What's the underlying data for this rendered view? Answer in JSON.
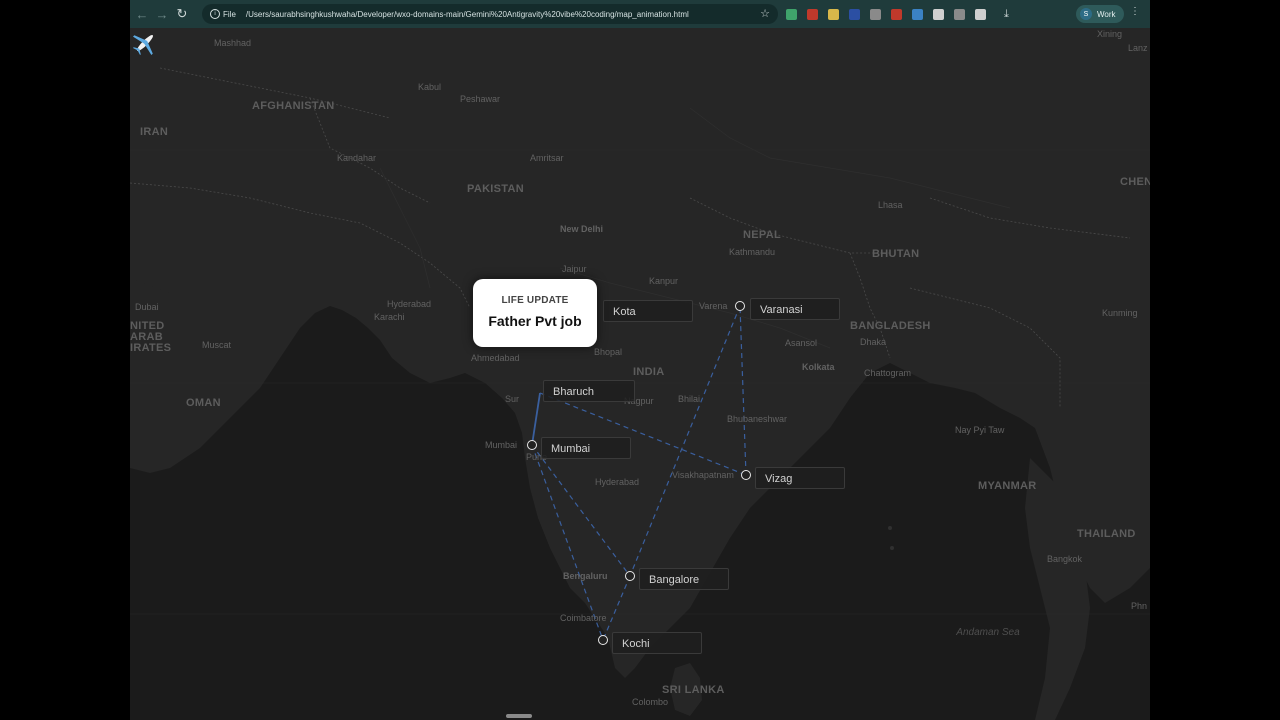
{
  "browser": {
    "url_scheme": "File",
    "url": "/Users/saurabhsinghkushwaha/Developer/wxo-domains-main/Gemini%20Antigravity%20vibe%20coding/map_animation.html",
    "profile_initial": "S",
    "profile_name": "Work",
    "extension_colors": [
      "#3fa36b",
      "#c0392b",
      "#d9b84a",
      "#2b4fa3",
      "#8a8a8a",
      "#c0392b",
      "#3b82c4",
      "#d0d0d0",
      "#8a8a8a",
      "#cfcfcf"
    ]
  },
  "map": {
    "countries": [
      "IRAN",
      "AFGHANISTAN",
      "PAKISTAN",
      "OMAN",
      "NEPAL",
      "BHUTAN",
      "BANGLADESH",
      "INDIA",
      "MYANMAR",
      "THAILAND",
      "SRI LANKA",
      "CHEN",
      "NITED",
      "ARAB",
      "IRATES"
    ],
    "cities": [
      "Mashhad",
      "Kabul",
      "Peshawar",
      "Kandahar",
      "Amritsar",
      "Lhasa",
      "Kathmandu",
      "New Delhi",
      "Jaipur",
      "Kanpur",
      "Hyderabad",
      "Karachi",
      "Dubai",
      "Muscat",
      "Ahmedabad",
      "Bhopal",
      "Nagpur",
      "Bhilai",
      "Asansol",
      "Dhaka",
      "Kolkata",
      "Chattogram",
      "Bhubaneshwar",
      "Nay Pyi Taw",
      "Kunming",
      "Mumbai",
      "Pune",
      "Hyderabad",
      "Visakhapatnam",
      "Bengaluru",
      "Coimbatore",
      "Colombo",
      "Bangkok",
      "Xining",
      "Lanz",
      "Phn",
      "Sur",
      "Varena"
    ],
    "seas": [
      "Andaman Sea"
    ]
  },
  "route": {
    "stops": [
      {
        "name": "Kota",
        "marker": false
      },
      {
        "name": "Varanasi",
        "marker": true
      },
      {
        "name": "Bharuch",
        "marker": false
      },
      {
        "name": "Mumbai",
        "marker": true
      },
      {
        "name": "Vizag",
        "marker": true
      },
      {
        "name": "Bangalore",
        "marker": true
      },
      {
        "name": "Kochi",
        "marker": true
      }
    ],
    "line_color": "#3a5f9e",
    "current_stop": "Bharuch"
  },
  "card": {
    "kicker": "LIFE UPDATE",
    "title": "Father Pvt job"
  }
}
